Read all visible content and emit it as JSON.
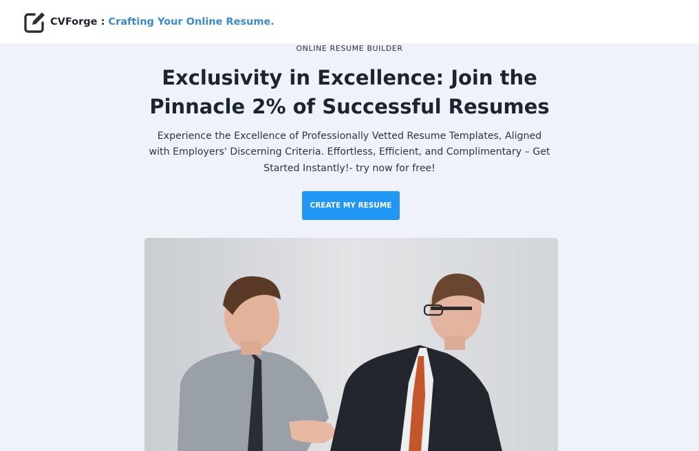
{
  "header": {
    "brand_name": "CVForge",
    "separator": " : ",
    "tagline": "Crafting Your Online Resume.",
    "logo_icon": "edit-square-icon"
  },
  "hero": {
    "eyebrow": "ONLINE RESUME BUILDER",
    "headline": "Exclusivity in Excellence: Join the Pinnacle 2% of Successful Resumes",
    "lead": "Experience the Excellence of Professionally Vetted Resume Templates, Aligned with Employers' Discerning Criteria. Effortless, Efficient, and Complimentary – Get Started Instantly!- try now for free!",
    "cta_label": "CREATE MY RESUME"
  },
  "colors": {
    "accent": "#2196f3",
    "tagline": "#3a8ad0",
    "page_bg": "#eff2f8"
  }
}
